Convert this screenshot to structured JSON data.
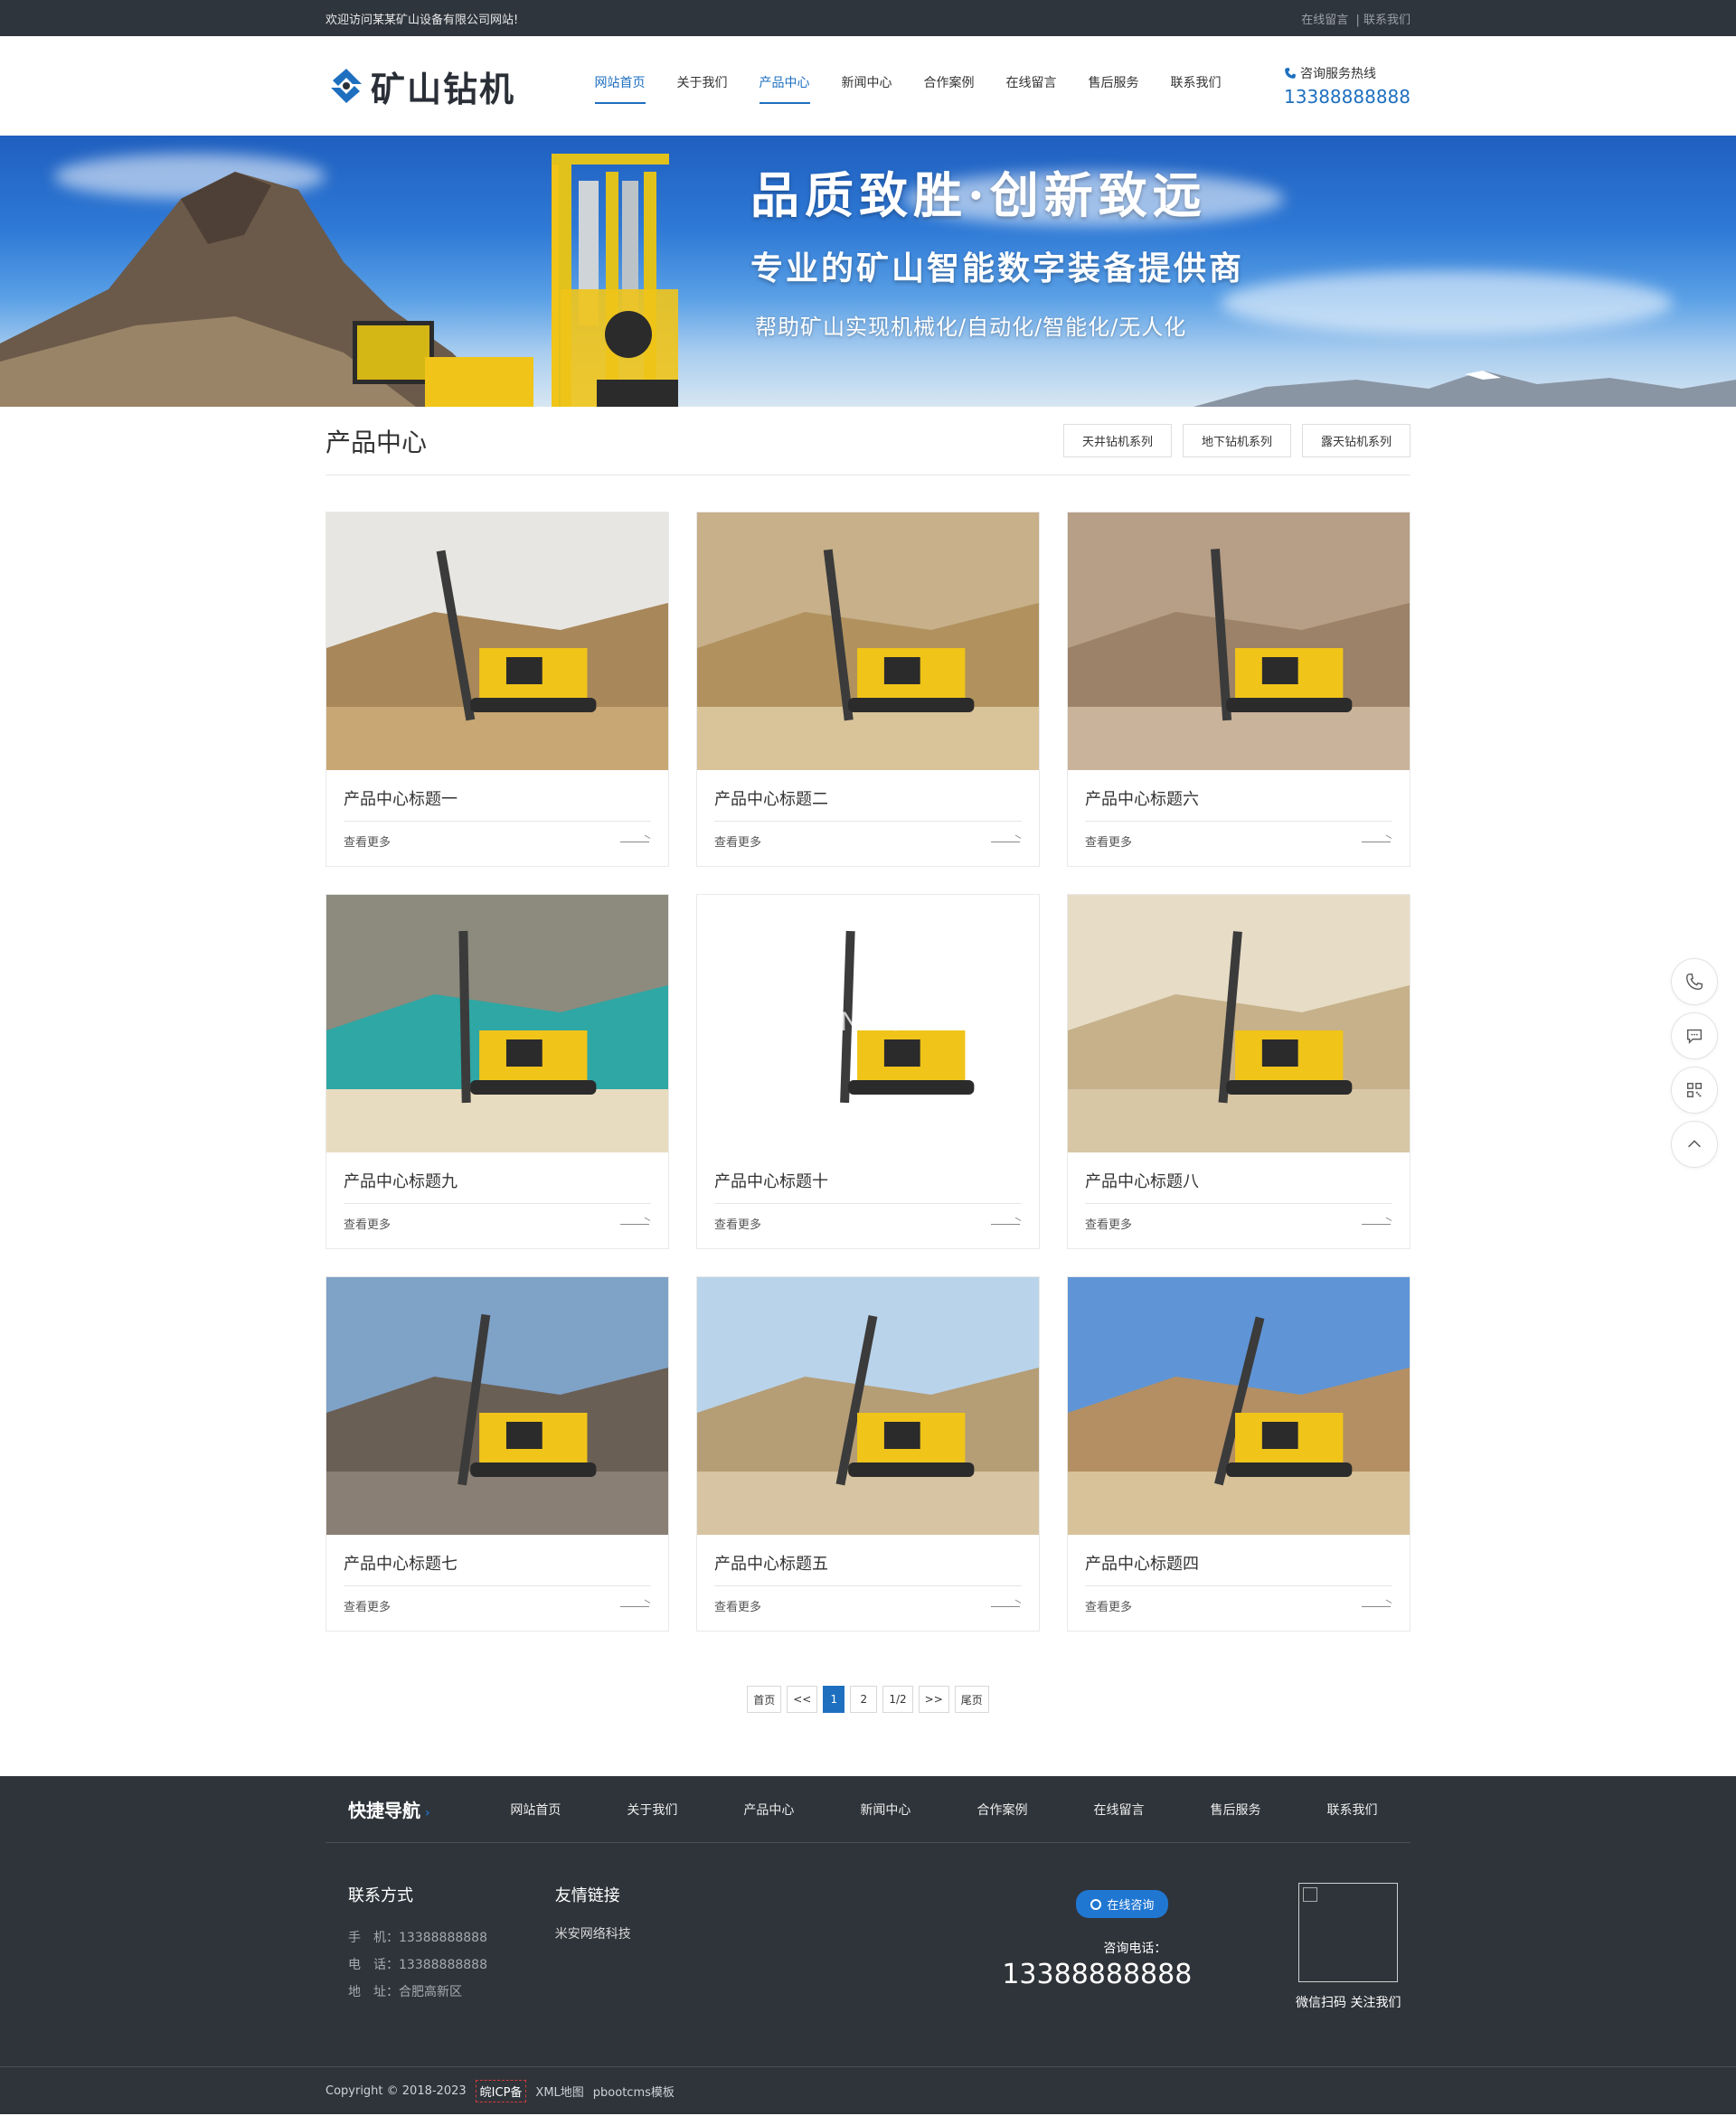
{
  "topbar": {
    "welcome": "欢迎访问某某矿山设备有限公司网站!",
    "link1": "在线留言",
    "sep": "|",
    "link2": "联系我们"
  },
  "header": {
    "logo_text": "矿山钻机",
    "nav": [
      "网站首页",
      "关于我们",
      "产品中心",
      "新闻中心",
      "合作案例",
      "在线留言",
      "售后服务",
      "联系我们"
    ],
    "hotline_label": "咨询服务热线",
    "hotline_number": "13388888888"
  },
  "banner": {
    "title": "品质致胜·创新致远",
    "subtitle": "专业的矿山智能数字装备提供商",
    "tagline": "帮助矿山实现机械化/自动化/智能化/无人化"
  },
  "section": {
    "title": "产品中心",
    "categories": [
      "天井钻机系列",
      "地下钻机系列",
      "露天钻机系列"
    ]
  },
  "products": [
    {
      "title": "产品中心标题一",
      "more": "查看更多",
      "scene": "quarry"
    },
    {
      "title": "产品中心标题二",
      "more": "查看更多",
      "scene": "rock"
    },
    {
      "title": "产品中心标题六",
      "more": "查看更多",
      "scene": "wall"
    },
    {
      "title": "产品中心标题九",
      "more": "查看更多",
      "scene": "lake"
    },
    {
      "title": "产品中心标题十",
      "more": "查看更多",
      "scene": "white",
      "watermark": "MIANWORK"
    },
    {
      "title": "产品中心标题八",
      "more": "查看更多",
      "scene": "sand"
    },
    {
      "title": "产品中心标题七",
      "more": "查看更多",
      "scene": "hill"
    },
    {
      "title": "产品中心标题五",
      "more": "查看更多",
      "scene": "sky"
    },
    {
      "title": "产品中心标题四",
      "more": "查看更多",
      "scene": "cloud"
    }
  ],
  "pager": {
    "first": "首页",
    "prev": "<<",
    "p1": "1",
    "p2": "2",
    "info": "1/2",
    "next": ">>",
    "last": "尾页"
  },
  "footer": {
    "nav_title": "快捷导航",
    "nav": [
      "网站首页",
      "关于我们",
      "产品中心",
      "新闻中心",
      "合作案例",
      "在线留言",
      "售后服务",
      "联系我们"
    ],
    "contact_title": "联系方式",
    "mobile": "手　机：13388888888",
    "phone": "电　话：13388888888",
    "address": "地　址：合肥高新区",
    "links_title": "友情链接",
    "link1": "米安网络科技",
    "consult_btn": "在线咨询",
    "consult_label": "咨询电话：",
    "consult_number": "13388888888",
    "qr_caption": "微信扫码 关注我们",
    "copyright": "Copyright © 2018-2023",
    "icp": "皖ICP备",
    "sitemap": "XML地图",
    "template": "pbootcms模板"
  },
  "colors": {
    "accent": "#1e6fbf",
    "topbar": "#2f353d",
    "footer": "#2f343a",
    "machine": "#f0c419"
  }
}
